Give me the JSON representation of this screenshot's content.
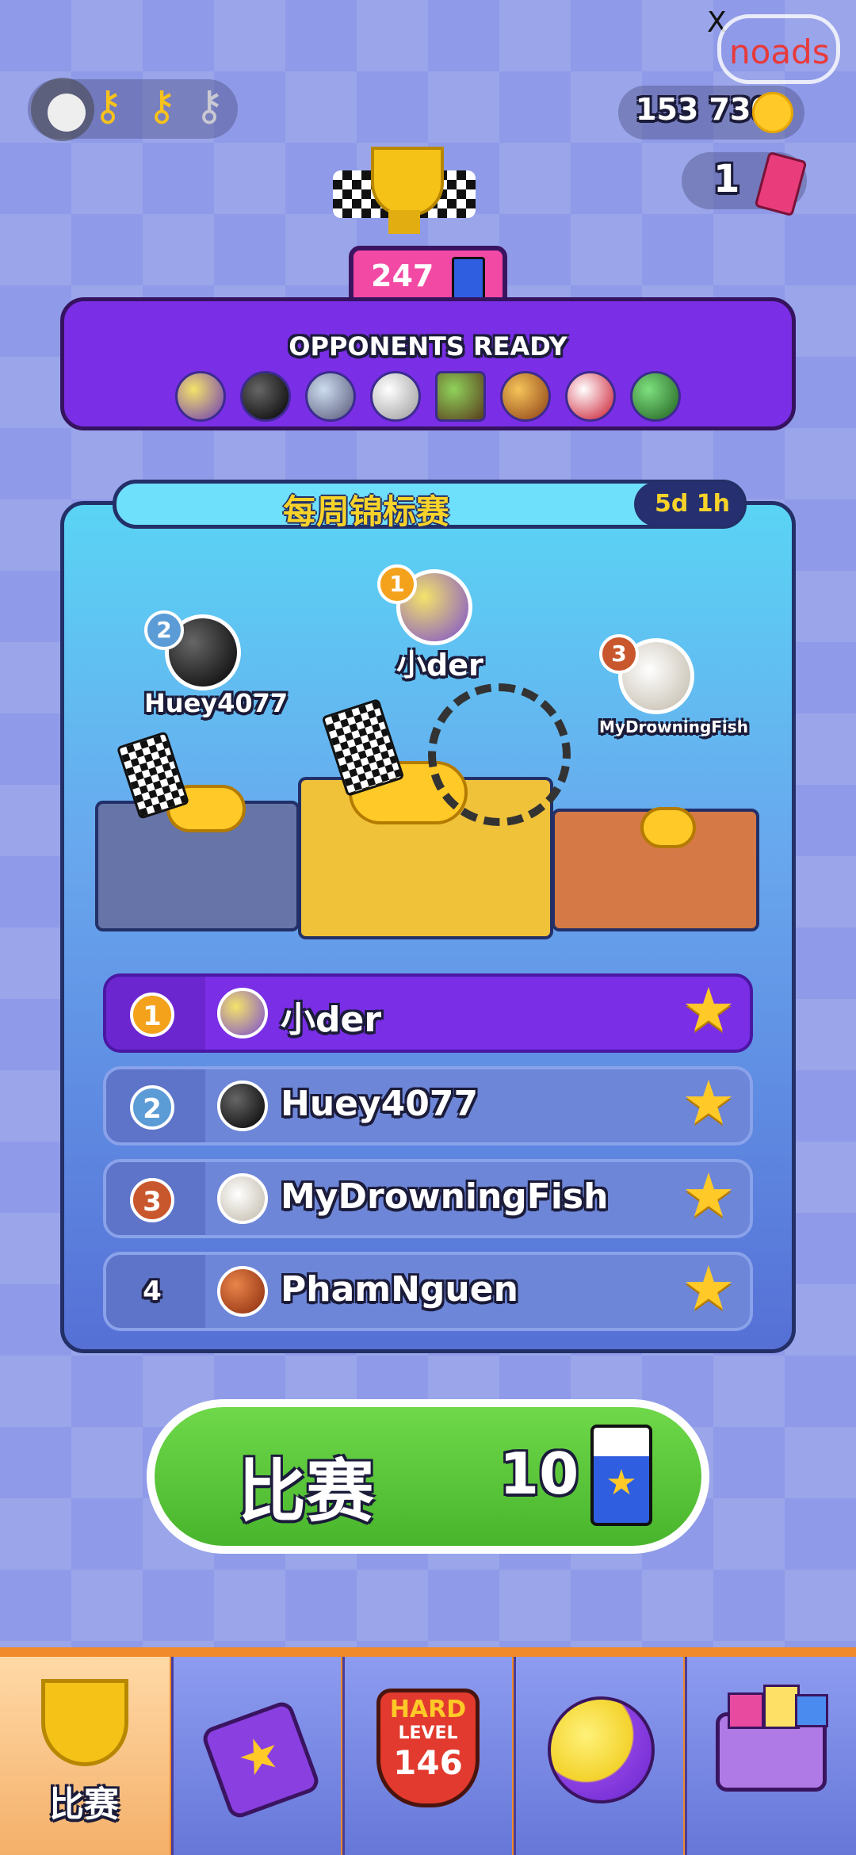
{
  "ads": {
    "close_label": "X",
    "noads_label": "noads"
  },
  "currency": {
    "coins": "153 730",
    "tickets": "1"
  },
  "trophy": {
    "points": "247"
  },
  "opponents": {
    "title": "OPPONENTS READY"
  },
  "tournament": {
    "title": "每周锦标赛",
    "time_left": "5d 1h",
    "podium": [
      {
        "rank": "1",
        "name": "小der"
      },
      {
        "rank": "2",
        "name": "Huey4077"
      },
      {
        "rank": "3",
        "name": "MyDrowningFish"
      }
    ],
    "leaderboard": [
      {
        "rank": "1",
        "name": "小der"
      },
      {
        "rank": "2",
        "name": "Huey4077"
      },
      {
        "rank": "3",
        "name": "MyDrowningFish"
      },
      {
        "rank": "4",
        "name": "PhamNguen"
      }
    ]
  },
  "play": {
    "label": "比赛",
    "cost": "10"
  },
  "nav": {
    "tab_race_label": "比赛",
    "level_tag": "HARD",
    "level_word": "LEVEL",
    "level_number": "146"
  },
  "colors": {
    "accent_purple": "#7a2ee6",
    "play_green": "#5ac83c",
    "gold": "#ffc928"
  }
}
